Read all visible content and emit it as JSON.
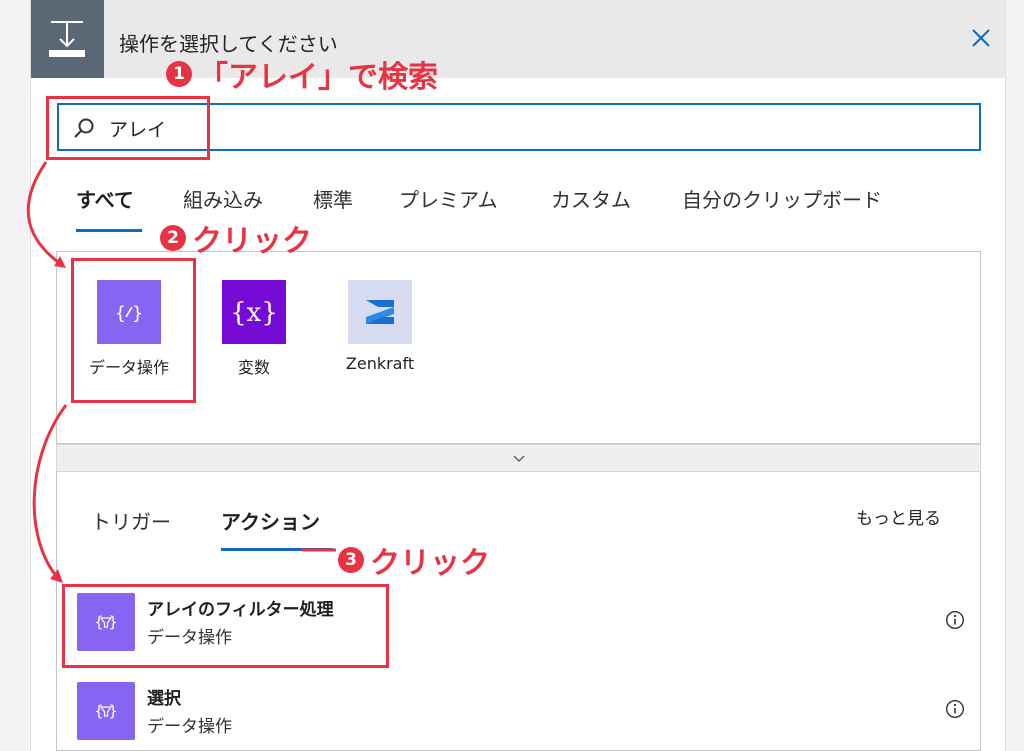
{
  "header": {
    "title": "操作を選択してください",
    "close_icon": "close-icon",
    "app_icon": "action-step-icon"
  },
  "search": {
    "value": "アレイ",
    "icon": "search-icon"
  },
  "category_tabs": [
    "すべて",
    "組み込み",
    "標準",
    "プレミアム",
    "カスタム",
    "自分のクリップボード"
  ],
  "active_category": "すべて",
  "connectors": [
    {
      "label": "データ操作",
      "icon": "data-operation-icon",
      "color": "#8764f2"
    },
    {
      "label": "変数",
      "icon": "variable-icon",
      "color": "#770bd6"
    },
    {
      "label": "Zenkraft",
      "icon": "zenkraft-logo",
      "color": "#d8dcf2"
    }
  ],
  "expand_icon": "chevron-down-icon",
  "sub_tabs": [
    "トリガー",
    "アクション"
  ],
  "active_sub_tab": "アクション",
  "more_link": "もっと見る",
  "actions": [
    {
      "name": "アレイのフィルター処理",
      "connector": "データ操作",
      "icon": "filter-array-icon"
    },
    {
      "name": "選択",
      "connector": "データ操作",
      "icon": "select-icon"
    }
  ],
  "annotations": {
    "step1": {
      "num": "1",
      "text": "「アレイ」で検索"
    },
    "step2": {
      "num": "2",
      "text": "クリック"
    },
    "step3": {
      "num": "3",
      "text": "クリック"
    },
    "color": "#e83345"
  }
}
